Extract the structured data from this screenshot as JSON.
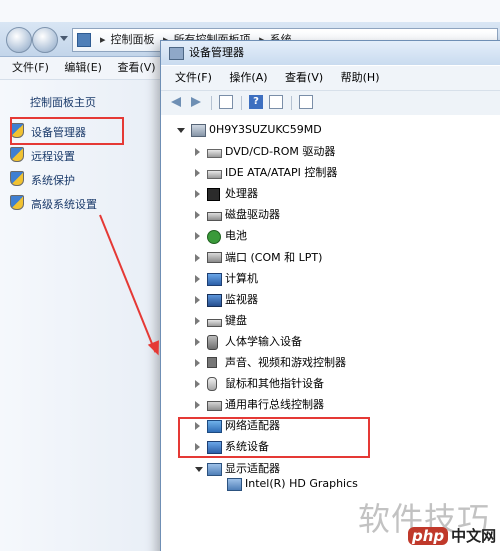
{
  "control_panel": {
    "breadcrumbs": [
      "控制面板",
      "所有控制面板项",
      "系统"
    ],
    "menu": [
      "文件(F)",
      "编辑(E)",
      "查看(V)"
    ],
    "home_link": "控制面板主页",
    "links": [
      "设备管理器",
      "远程设置",
      "系统保护",
      "高级系统设置"
    ]
  },
  "device_manager": {
    "title": "设备管理器",
    "menu": [
      "文件(F)",
      "操作(A)",
      "查看(V)",
      "帮助(H)"
    ],
    "root": "0H9Y3SUZUKC59MD",
    "categories": [
      {
        "label": "DVD/CD-ROM 驱动器",
        "icon": "disc-drive-icon"
      },
      {
        "label": "IDE ATA/ATAPI 控制器",
        "icon": "ide-controller-icon"
      },
      {
        "label": "处理器",
        "icon": "processor-icon"
      },
      {
        "label": "磁盘驱动器",
        "icon": "disk-drive-icon"
      },
      {
        "label": "电池",
        "icon": "battery-icon"
      },
      {
        "label": "端口 (COM 和 LPT)",
        "icon": "port-icon"
      },
      {
        "label": "计算机",
        "icon": "computer-icon"
      },
      {
        "label": "监视器",
        "icon": "monitor-icon"
      },
      {
        "label": "键盘",
        "icon": "keyboard-icon"
      },
      {
        "label": "人体学输入设备",
        "icon": "hid-icon"
      },
      {
        "label": "声音、视频和游戏控制器",
        "icon": "sound-icon"
      },
      {
        "label": "鼠标和其他指针设备",
        "icon": "mouse-icon"
      },
      {
        "label": "通用串行总线控制器",
        "icon": "usb-icon"
      },
      {
        "label": "网络适配器",
        "icon": "network-adapter-icon"
      },
      {
        "label": "系统设备",
        "icon": "system-device-icon"
      },
      {
        "label": "显示适配器",
        "icon": "display-adapter-icon",
        "expanded": true
      }
    ],
    "display_child": "Intel(R) HD Graphics"
  },
  "watermark": "软件技巧",
  "brand": {
    "php": "php",
    "cn": "中文网"
  },
  "colors": {
    "annotation": "#e53935",
    "link": "#1a3a6a"
  }
}
